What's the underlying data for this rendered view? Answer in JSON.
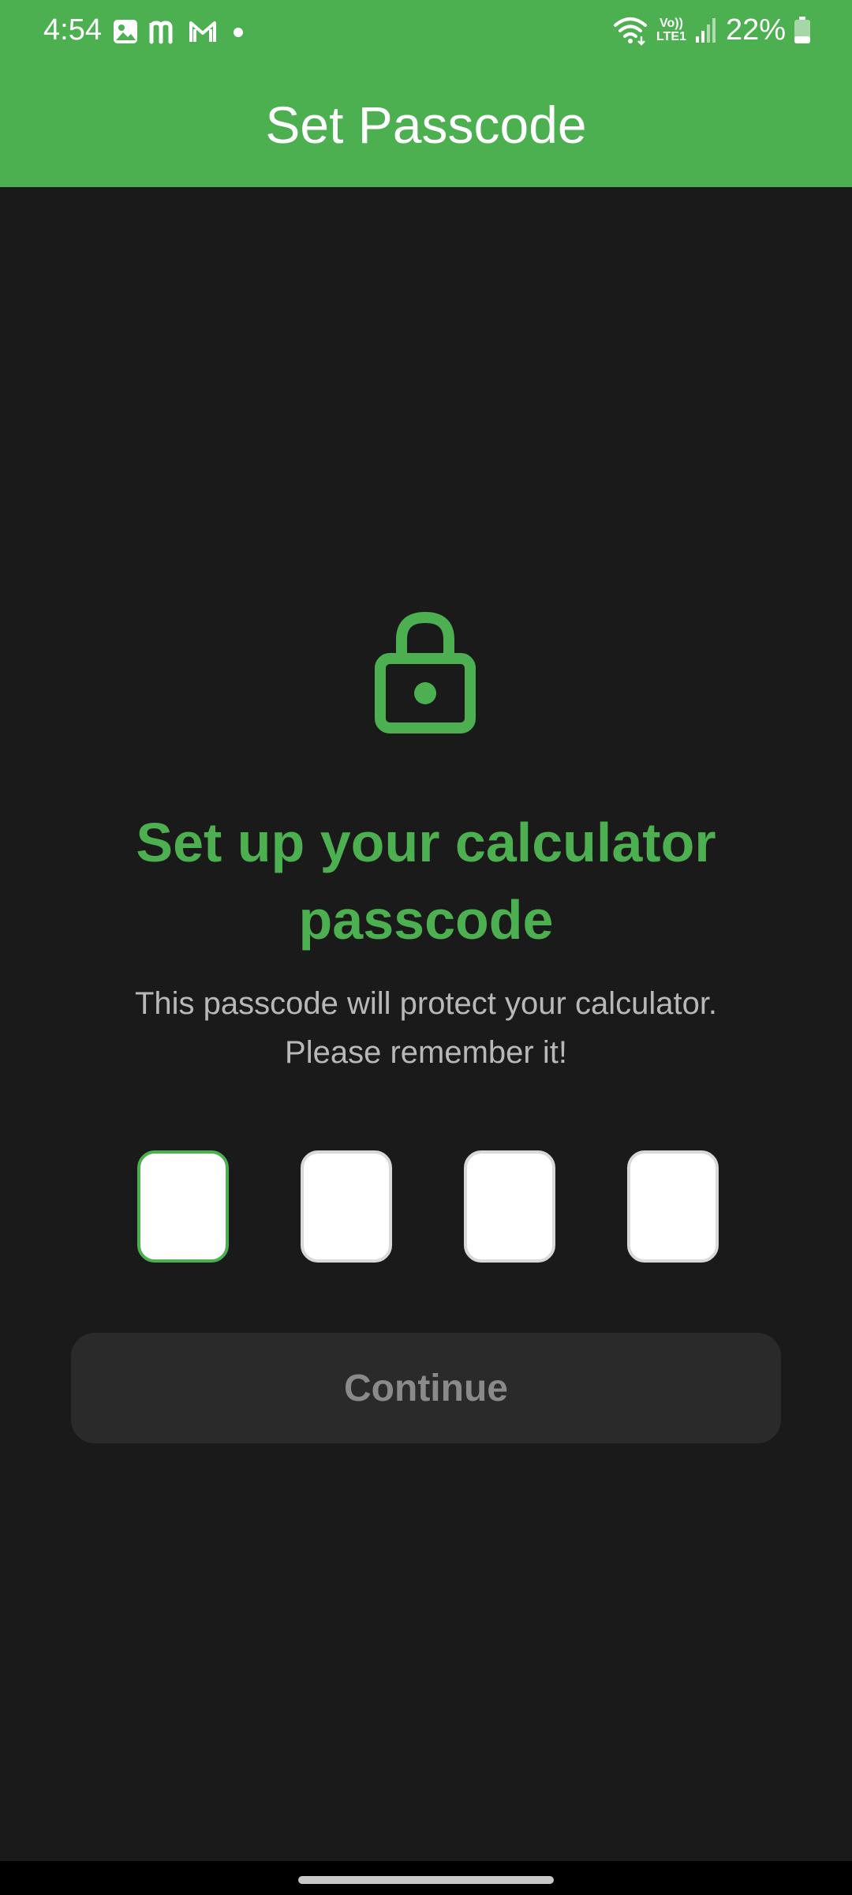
{
  "status_bar": {
    "time": "4:54",
    "battery": "22%",
    "icons": [
      "gallery-icon",
      "m-app-icon",
      "gmail-icon",
      "dot-icon",
      "wifi-icon",
      "volte-icon",
      "signal-icon",
      "battery-icon"
    ],
    "volte_label_top": "Vo))",
    "volte_label_bottom": "LTE1"
  },
  "app_bar": {
    "title": "Set Passcode"
  },
  "main": {
    "title": "Set up your calculator passcode",
    "subtitle_line1": "This passcode will protect your calculator.",
    "subtitle_line2": "Please remember it!",
    "code_boxes": [
      "",
      "",
      "",
      ""
    ],
    "continue_label": "Continue"
  },
  "colors": {
    "accent": "#4caf50",
    "background": "#1a1a1a",
    "button_bg": "#2a2a2a",
    "button_text": "#8a8a8a",
    "subtitle": "#b8b8b8"
  }
}
